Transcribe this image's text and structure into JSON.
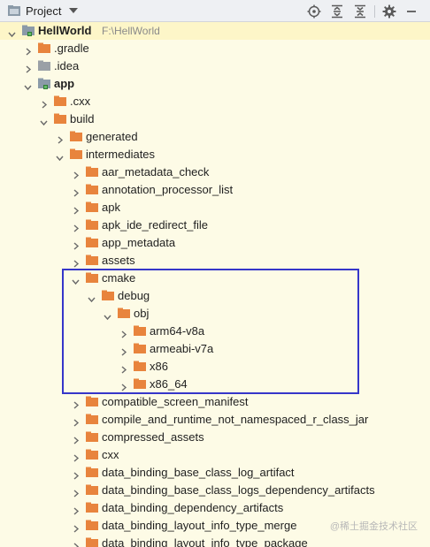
{
  "toolbar": {
    "title": "Project",
    "icons": [
      "locate-icon",
      "expand-all-icon",
      "collapse-all-icon",
      "gear-icon",
      "minimize-icon"
    ]
  },
  "colors": {
    "folder": "#e8843d",
    "folder_grey": "#9aa0a6",
    "selection": "#3636c9",
    "row_highlight": "#fdf6c8"
  },
  "tree": [
    {
      "label": "HellWorld",
      "path": "F:\\HellWorld",
      "depth": 0,
      "expanded": true,
      "bold": true,
      "icon": "module-folder",
      "chevron": true
    },
    {
      "label": ".gradle",
      "depth": 1,
      "expanded": false,
      "icon": "orange-folder",
      "chevron": true
    },
    {
      "label": ".idea",
      "depth": 1,
      "expanded": false,
      "icon": "grey-folder",
      "chevron": true
    },
    {
      "label": "app",
      "depth": 1,
      "expanded": true,
      "bold": true,
      "icon": "module-folder",
      "chevron": true
    },
    {
      "label": ".cxx",
      "depth": 2,
      "expanded": false,
      "icon": "orange-folder",
      "chevron": true
    },
    {
      "label": "build",
      "depth": 2,
      "expanded": true,
      "icon": "orange-folder",
      "chevron": true
    },
    {
      "label": "generated",
      "depth": 3,
      "expanded": false,
      "icon": "orange-folder",
      "chevron": true
    },
    {
      "label": "intermediates",
      "depth": 3,
      "expanded": true,
      "icon": "orange-folder",
      "chevron": true
    },
    {
      "label": "aar_metadata_check",
      "depth": 4,
      "expanded": false,
      "icon": "orange-folder",
      "chevron": true
    },
    {
      "label": "annotation_processor_list",
      "depth": 4,
      "expanded": false,
      "icon": "orange-folder",
      "chevron": true
    },
    {
      "label": "apk",
      "depth": 4,
      "expanded": false,
      "icon": "orange-folder",
      "chevron": true
    },
    {
      "label": "apk_ide_redirect_file",
      "depth": 4,
      "expanded": false,
      "icon": "orange-folder",
      "chevron": true
    },
    {
      "label": "app_metadata",
      "depth": 4,
      "expanded": false,
      "icon": "orange-folder",
      "chevron": true
    },
    {
      "label": "assets",
      "depth": 4,
      "expanded": false,
      "icon": "orange-folder",
      "chevron": true
    },
    {
      "label": "cmake",
      "depth": 4,
      "expanded": true,
      "icon": "orange-folder",
      "chevron": true
    },
    {
      "label": "debug",
      "depth": 5,
      "expanded": true,
      "icon": "orange-folder",
      "chevron": true
    },
    {
      "label": "obj",
      "depth": 6,
      "expanded": true,
      "icon": "orange-folder",
      "chevron": true
    },
    {
      "label": "arm64-v8a",
      "depth": 7,
      "expanded": false,
      "icon": "orange-folder",
      "chevron": true
    },
    {
      "label": "armeabi-v7a",
      "depth": 7,
      "expanded": false,
      "icon": "orange-folder",
      "chevron": true
    },
    {
      "label": "x86",
      "depth": 7,
      "expanded": false,
      "icon": "orange-folder",
      "chevron": true
    },
    {
      "label": "x86_64",
      "depth": 7,
      "expanded": false,
      "icon": "orange-folder",
      "chevron": true
    },
    {
      "label": "compatible_screen_manifest",
      "depth": 4,
      "expanded": false,
      "icon": "orange-folder",
      "chevron": true
    },
    {
      "label": "compile_and_runtime_not_namespaced_r_class_jar",
      "depth": 4,
      "expanded": false,
      "icon": "orange-folder",
      "chevron": true
    },
    {
      "label": "compressed_assets",
      "depth": 4,
      "expanded": false,
      "icon": "orange-folder",
      "chevron": true
    },
    {
      "label": "cxx",
      "depth": 4,
      "expanded": false,
      "icon": "orange-folder",
      "chevron": true
    },
    {
      "label": "data_binding_base_class_log_artifact",
      "depth": 4,
      "expanded": false,
      "icon": "orange-folder",
      "chevron": true
    },
    {
      "label": "data_binding_base_class_logs_dependency_artifacts",
      "depth": 4,
      "expanded": false,
      "icon": "orange-folder",
      "chevron": true
    },
    {
      "label": "data_binding_dependency_artifacts",
      "depth": 4,
      "expanded": false,
      "icon": "orange-folder",
      "chevron": true
    },
    {
      "label": "data_binding_layout_info_type_merge",
      "depth": 4,
      "expanded": false,
      "icon": "orange-folder",
      "chevron": true
    },
    {
      "label": "data_binding_layout_info_type_package",
      "depth": 4,
      "expanded": false,
      "icon": "orange-folder",
      "chevron": true
    }
  ],
  "watermark": "@稀土掘金技术社区"
}
